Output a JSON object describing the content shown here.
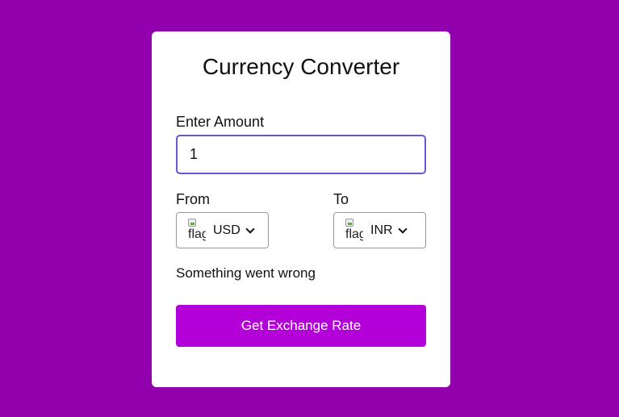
{
  "app": {
    "title": "Currency Converter"
  },
  "amount": {
    "label": "Enter Amount",
    "value": "1"
  },
  "from": {
    "label": "From",
    "flag_alt": "flag",
    "currency": "USD"
  },
  "to": {
    "label": "To",
    "flag_alt": "flag",
    "currency": "INR"
  },
  "status": {
    "message": "Something went wrong"
  },
  "actions": {
    "submit_label": "Get Exchange Rate"
  },
  "colors": {
    "background": "#9000ad",
    "card": "#ffffff",
    "input_border": "#6a55d6",
    "button": "#b300d9",
    "button_text": "#ffffff"
  },
  "icons": {
    "flag": "broken-image-icon",
    "dropdown": "chevron-down-icon"
  }
}
